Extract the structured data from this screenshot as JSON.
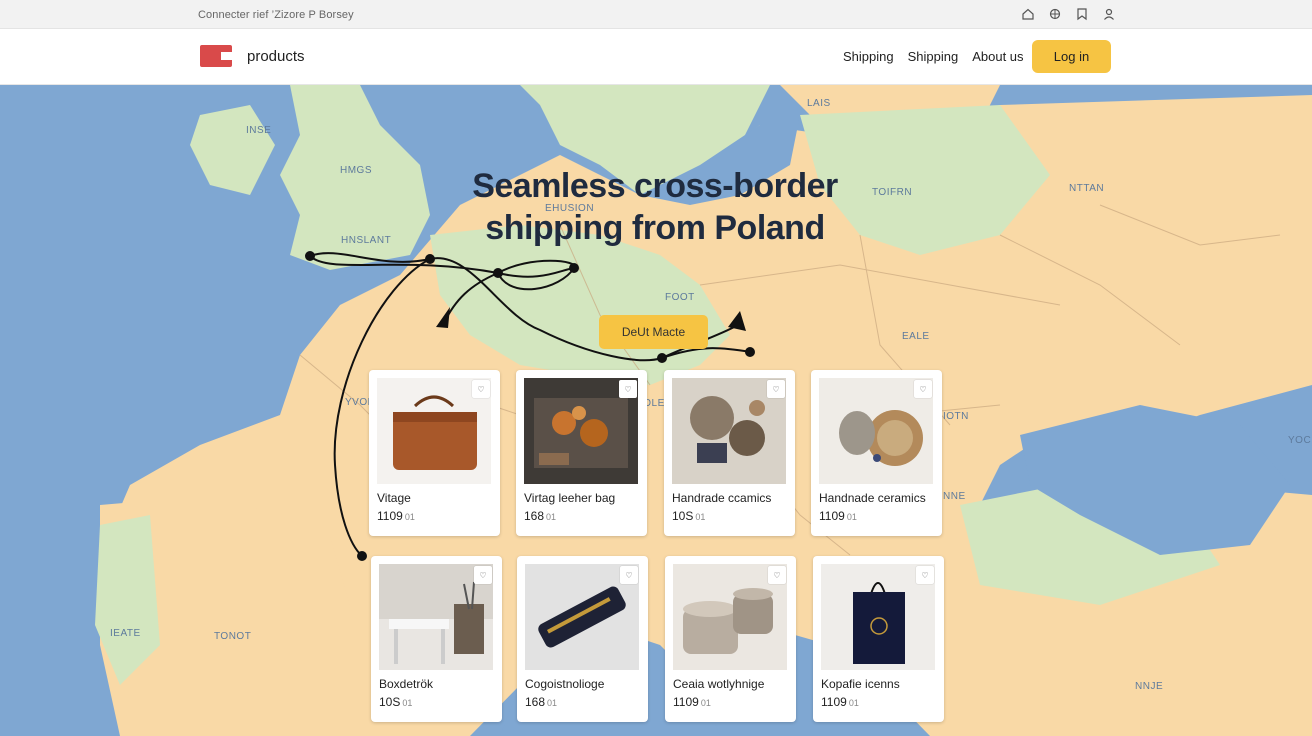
{
  "topbar": {
    "text": "Connecter rief ’Zizore P Borsey"
  },
  "header": {
    "brand": "products",
    "nav": [
      "Shipping",
      "Shipping",
      "About us"
    ],
    "login_label": "Log in"
  },
  "hero": {
    "line1": "Seamless cross-border",
    "line2": "shipping from Poland",
    "cta_label": "DeUt Macte"
  },
  "map_labels": [
    "LAIS",
    "TOIFRN",
    "NTTAN",
    "HMGS",
    "HNSLANT",
    "EHUSION",
    "FOOT",
    "EALE",
    "YVON",
    "TONOT",
    "NNJE",
    "IOTN",
    "IOLE",
    "IEATE",
    "INSE",
    "NNE",
    "YOC"
  ],
  "products": [
    {
      "title": "Vitage",
      "price": "1109",
      "unit": "01",
      "image": "leather-bag"
    },
    {
      "title": "Virtag leeher bag",
      "price": "168",
      "unit": "01",
      "image": "tray-crafts"
    },
    {
      "title": "Handrade ccamics",
      "price": "10S",
      "unit": "01",
      "image": "beads"
    },
    {
      "title": "Handnade ceramics",
      "price": "1109",
      "unit": "01",
      "image": "ceramics"
    },
    {
      "title": "Boxdetrök",
      "price": "10S",
      "unit": "01",
      "image": "desk"
    },
    {
      "title": "Cogoistnolioge",
      "price": "168",
      "unit": "01",
      "image": "usb-stick"
    },
    {
      "title": "Ceaia wotlyhnige",
      "price": "1109",
      "unit": "01",
      "image": "mugs"
    },
    {
      "title": "Kopafie icenns",
      "price": "1109",
      "unit": "01",
      "image": "tote-bag"
    }
  ]
}
